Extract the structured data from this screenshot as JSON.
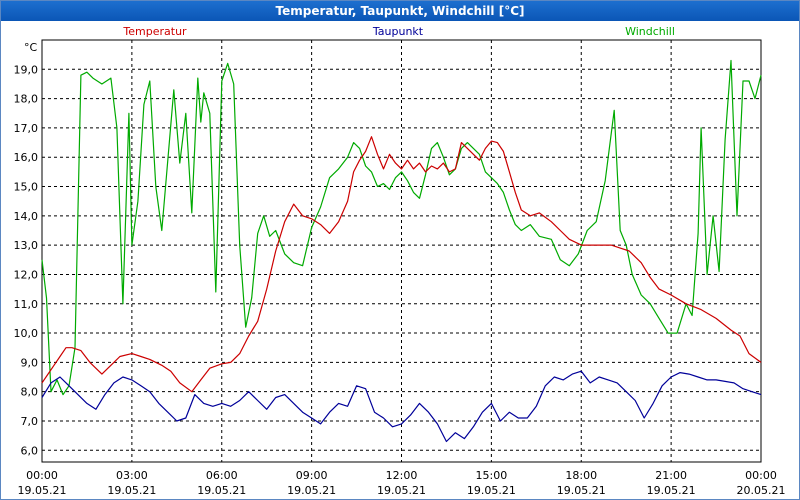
{
  "window": {
    "title": "Temperatur, Taupunkt, Windchill [°C]"
  },
  "chart_data": {
    "type": "line",
    "title": "Temperatur, Taupunkt, Windchill [°C]",
    "ylabel": "°C",
    "xlabel": "",
    "ylim": [
      5.6,
      20.0
    ],
    "xlim_hours": [
      0,
      24
    ],
    "grid": true,
    "legend_placement": "top",
    "x_ticks": [
      {
        "time": "00:00",
        "date": "19.05.21"
      },
      {
        "time": "03:00",
        "date": "19.05.21"
      },
      {
        "time": "06:00",
        "date": "19.05.21"
      },
      {
        "time": "09:00",
        "date": "19.05.21"
      },
      {
        "time": "12:00",
        "date": "19.05.21"
      },
      {
        "time": "15:00",
        "date": "19.05.21"
      },
      {
        "time": "18:00",
        "date": "19.05.21"
      },
      {
        "time": "21:00",
        "date": "19.05.21"
      },
      {
        "time": "00:00",
        "date": "20.05.21"
      }
    ],
    "y_ticks": [
      "6,0",
      "7,0",
      "8,0",
      "9,0",
      "10,0",
      "11,0",
      "12,0",
      "13,0",
      "14,0",
      "15,0",
      "16,0",
      "17,0",
      "18,0",
      "19,0"
    ],
    "series": [
      {
        "name": "Temperatur",
        "color": "#cc0000",
        "x": [
          0,
          0.2,
          0.4,
          0.6,
          0.8,
          1.0,
          1.3,
          1.6,
          2.0,
          2.3,
          2.6,
          3.0,
          3.3,
          3.6,
          4.0,
          4.3,
          4.6,
          5.0,
          5.3,
          5.6,
          6.0,
          6.3,
          6.6,
          6.9,
          7.2,
          7.5,
          7.8,
          8.1,
          8.4,
          8.7,
          9.0,
          9.3,
          9.6,
          9.9,
          10.2,
          10.4,
          10.6,
          10.8,
          11.0,
          11.2,
          11.4,
          11.6,
          11.8,
          12.0,
          12.2,
          12.4,
          12.6,
          12.8,
          13.0,
          13.2,
          13.4,
          13.6,
          13.8,
          14.0,
          14.2,
          14.4,
          14.6,
          14.8,
          15.0,
          15.2,
          15.4,
          15.6,
          15.8,
          16.0,
          16.3,
          16.6,
          17.0,
          17.3,
          17.6,
          18.0,
          18.5,
          19.0,
          19.3,
          19.6,
          20.0,
          20.3,
          20.6,
          21.0,
          21.5,
          22.0,
          22.5,
          23.0,
          23.3,
          23.6,
          24.0
        ],
        "values": [
          8.3,
          8.6,
          8.9,
          9.2,
          9.5,
          9.5,
          9.4,
          9.0,
          8.6,
          8.9,
          9.2,
          9.3,
          9.2,
          9.1,
          8.9,
          8.7,
          8.3,
          8.0,
          8.4,
          8.8,
          8.95,
          9.0,
          9.3,
          9.9,
          10.4,
          11.5,
          12.8,
          13.8,
          14.4,
          14.0,
          13.9,
          13.7,
          13.4,
          13.8,
          14.5,
          15.5,
          15.9,
          16.2,
          16.7,
          16.1,
          15.6,
          16.1,
          15.8,
          15.6,
          15.9,
          15.6,
          15.8,
          15.5,
          15.7,
          15.6,
          15.8,
          15.5,
          15.6,
          16.5,
          16.3,
          16.1,
          15.9,
          16.3,
          16.55,
          16.5,
          16.2,
          15.5,
          14.8,
          14.2,
          14.0,
          14.1,
          13.8,
          13.5,
          13.2,
          13.0,
          13.0,
          13.0,
          12.9,
          12.8,
          12.4,
          11.9,
          11.5,
          11.3,
          11.0,
          10.8,
          10.5,
          10.1,
          9.9,
          9.3,
          9.0
        ]
      },
      {
        "name": "Taupunkt",
        "color": "#000099",
        "x": [
          0,
          0.3,
          0.6,
          0.9,
          1.2,
          1.5,
          1.8,
          2.1,
          2.4,
          2.7,
          3.0,
          3.3,
          3.6,
          3.9,
          4.2,
          4.5,
          4.8,
          5.1,
          5.4,
          5.7,
          6.0,
          6.3,
          6.6,
          6.9,
          7.2,
          7.5,
          7.8,
          8.1,
          8.4,
          8.7,
          9.0,
          9.3,
          9.6,
          9.9,
          10.2,
          10.5,
          10.8,
          11.1,
          11.4,
          11.7,
          12.0,
          12.3,
          12.6,
          12.9,
          13.2,
          13.5,
          13.8,
          14.1,
          14.4,
          14.7,
          15.0,
          15.3,
          15.6,
          15.9,
          16.2,
          16.5,
          16.8,
          17.1,
          17.4,
          17.7,
          18.0,
          18.3,
          18.6,
          18.9,
          19.2,
          19.5,
          19.8,
          20.1,
          20.4,
          20.7,
          21.0,
          21.3,
          21.6,
          21.9,
          22.2,
          22.5,
          22.8,
          23.1,
          23.4,
          23.7,
          24.0
        ],
        "values": [
          7.8,
          8.3,
          8.5,
          8.2,
          7.9,
          7.6,
          7.4,
          7.9,
          8.3,
          8.5,
          8.4,
          8.2,
          8.0,
          7.6,
          7.3,
          7.0,
          7.1,
          7.9,
          7.6,
          7.5,
          7.6,
          7.5,
          7.7,
          8.0,
          7.7,
          7.4,
          7.8,
          7.9,
          7.6,
          7.3,
          7.1,
          6.9,
          7.3,
          7.6,
          7.5,
          8.2,
          8.1,
          7.3,
          7.1,
          6.8,
          6.9,
          7.2,
          7.6,
          7.3,
          6.9,
          6.3,
          6.6,
          6.4,
          6.8,
          7.3,
          7.6,
          7.0,
          7.3,
          7.1,
          7.1,
          7.5,
          8.2,
          8.5,
          8.4,
          8.6,
          8.7,
          8.3,
          8.5,
          8.4,
          8.3,
          8.0,
          7.7,
          7.1,
          7.6,
          8.2,
          8.5,
          8.65,
          8.6,
          8.5,
          8.4,
          8.4,
          8.35,
          8.3,
          8.1,
          8.0,
          7.9
        ]
      },
      {
        "name": "Windchill",
        "color": "#00aa00",
        "x": [
          0,
          0.15,
          0.3,
          0.5,
          0.7,
          0.9,
          1.1,
          1.3,
          1.5,
          1.7,
          2.0,
          2.3,
          2.5,
          2.7,
          2.9,
          3.0,
          3.2,
          3.4,
          3.6,
          3.8,
          4.0,
          4.2,
          4.4,
          4.6,
          4.8,
          5.0,
          5.2,
          5.3,
          5.4,
          5.6,
          5.8,
          6.0,
          6.2,
          6.4,
          6.6,
          6.8,
          7.0,
          7.2,
          7.4,
          7.6,
          7.8,
          8.1,
          8.4,
          8.7,
          9.0,
          9.3,
          9.6,
          9.9,
          10.2,
          10.4,
          10.6,
          10.8,
          11.0,
          11.2,
          11.4,
          11.6,
          11.8,
          12.0,
          12.2,
          12.4,
          12.6,
          12.8,
          13.0,
          13.2,
          13.4,
          13.6,
          13.8,
          14.0,
          14.2,
          14.4,
          14.6,
          14.8,
          15.0,
          15.2,
          15.4,
          15.6,
          15.8,
          16.0,
          16.3,
          16.6,
          17.0,
          17.3,
          17.6,
          17.9,
          18.2,
          18.5,
          18.8,
          19.1,
          19.3,
          19.5,
          19.7,
          20.0,
          20.3,
          20.6,
          20.9,
          21.2,
          21.5,
          21.7,
          21.9,
          22.0,
          22.2,
          22.4,
          22.6,
          22.8,
          23.0,
          23.2,
          23.4,
          23.6,
          23.8,
          24.0
        ],
        "values": [
          12.5,
          11.2,
          8.0,
          8.4,
          7.9,
          8.2,
          9.5,
          18.8,
          18.9,
          18.7,
          18.5,
          18.7,
          17.0,
          11.0,
          17.5,
          13.0,
          14.5,
          17.8,
          18.6,
          15.0,
          13.5,
          15.9,
          18.3,
          15.8,
          17.5,
          14.1,
          18.7,
          17.2,
          18.2,
          17.5,
          11.4,
          18.6,
          19.2,
          18.5,
          13.0,
          10.2,
          11.2,
          13.4,
          14.0,
          13.3,
          13.5,
          12.7,
          12.4,
          12.3,
          13.6,
          14.3,
          15.3,
          15.6,
          16.0,
          16.5,
          16.3,
          15.7,
          15.5,
          15.0,
          15.1,
          14.9,
          15.3,
          15.5,
          15.2,
          14.8,
          14.6,
          15.4,
          16.3,
          16.5,
          16.0,
          15.4,
          15.6,
          16.3,
          16.5,
          16.3,
          16.1,
          15.5,
          15.3,
          15.1,
          14.8,
          14.2,
          13.7,
          13.5,
          13.7,
          13.3,
          13.2,
          12.5,
          12.3,
          12.7,
          13.5,
          13.8,
          15.2,
          17.6,
          13.5,
          13.0,
          12.0,
          11.3,
          11.0,
          10.5,
          10.0,
          10.0,
          11.0,
          10.6,
          13.4,
          17.0,
          12.0,
          14.0,
          12.1,
          16.6,
          19.3,
          14.0,
          18.6,
          18.6,
          18.0,
          18.8
        ]
      }
    ]
  }
}
